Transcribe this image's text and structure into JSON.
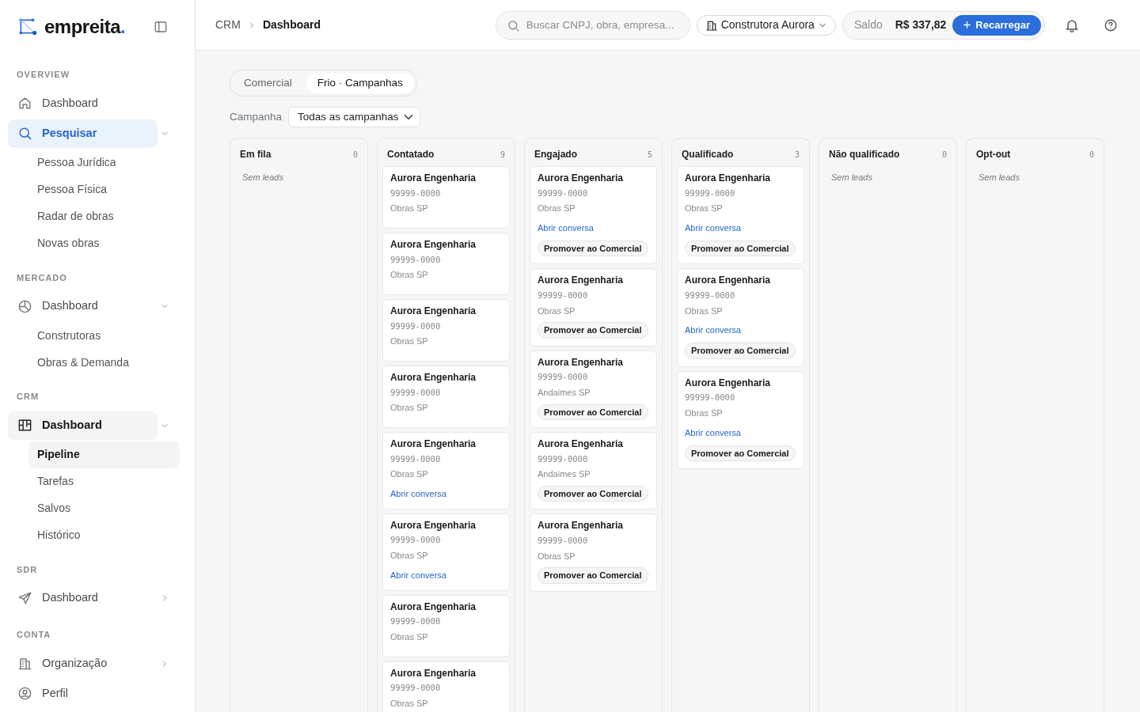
{
  "brand": {
    "name": "empreita",
    "dot": "."
  },
  "sidebar": {
    "sections": [
      {
        "title": "OVERVIEW",
        "items": [
          {
            "label": "Dashboard",
            "kind": "home",
            "selected": false
          },
          {
            "label": "Pesquisar",
            "kind": "search",
            "selected": true,
            "expanded": true,
            "children": [
              {
                "label": "Pessoa Jurídica",
                "selected": false
              },
              {
                "label": "Pessoa Física",
                "selected": false
              },
              {
                "label": "Radar de obras",
                "selected": false
              },
              {
                "label": "Novas obras",
                "selected": false
              }
            ]
          }
        ]
      },
      {
        "title": "MERCADO",
        "items": [
          {
            "label": "Dashboard",
            "kind": "pie",
            "selected": false,
            "expanded": true,
            "children": [
              {
                "label": "Construtoras",
                "selected": false
              },
              {
                "label": "Obras & Demanda",
                "selected": false
              }
            ]
          }
        ]
      },
      {
        "title": "CRM",
        "items": [
          {
            "label": "Dashboard",
            "kind": "board",
            "selected": false,
            "open": true,
            "expanded": true,
            "children": [
              {
                "label": "Pipeline",
                "selected": true
              },
              {
                "label": "Tarefas",
                "selected": false
              },
              {
                "label": "Salvos",
                "selected": false
              },
              {
                "label": "Histórico",
                "selected": false
              }
            ]
          }
        ]
      },
      {
        "title": "SDR",
        "items": [
          {
            "label": "Dashboard",
            "kind": "send",
            "selected": false,
            "expanded": false
          }
        ]
      },
      {
        "title": "CONTA",
        "items": [
          {
            "label": "Organização",
            "kind": "building",
            "selected": false,
            "expanded": false
          },
          {
            "label": "Perfil",
            "kind": "user",
            "selected": false
          }
        ]
      }
    ]
  },
  "breadcrumb": [
    "CRM",
    "Dashboard"
  ],
  "search": {
    "placeholder": "Buscar CNPJ, obra, empresa..."
  },
  "company": "Construtora Aurora",
  "balance": {
    "label": "Saldo",
    "value": "R$ 337,82",
    "button": "Recarregar"
  },
  "tabs": [
    {
      "label": "Comercial",
      "selected": false
    },
    {
      "label": "Frio · Campanhas",
      "selected": true
    }
  ],
  "filter": {
    "label": "Campanha",
    "value": "Todas as campanhas"
  },
  "columns": [
    {
      "title": "Em fila",
      "count": "0",
      "empty": "Sem leads"
    },
    {
      "title": "Contatado",
      "count": "9",
      "cards": [
        {
          "name": "Aurora Engenharia",
          "phone": "99999-0000",
          "segment": "Obras SP"
        },
        {
          "name": "Aurora Engenharia",
          "phone": "99999-0000",
          "segment": "Obras SP"
        },
        {
          "name": "Aurora Engenharia",
          "phone": "99999-0000",
          "segment": "Obras SP"
        },
        {
          "name": "Aurora Engenharia",
          "phone": "99999-0000",
          "segment": "Obras SP"
        },
        {
          "name": "Aurora Engenharia",
          "phone": "99999-0000",
          "segment": "Obras SP",
          "link": "Abrir conversa"
        },
        {
          "name": "Aurora Engenharia",
          "phone": "99999-0000",
          "segment": "Obras SP",
          "link": "Abrir conversa"
        },
        {
          "name": "Aurora Engenharia",
          "phone": "99999-0000",
          "segment": "Obras SP"
        },
        {
          "name": "Aurora Engenharia",
          "phone": "99999-0000",
          "segment": "Obras SP"
        }
      ]
    },
    {
      "title": "Engajado",
      "count": "5",
      "cards": [
        {
          "name": "Aurora Engenharia",
          "phone": "99999-0000",
          "segment": "Obras SP",
          "link": "Abrir conversa",
          "action": "Promover ao Comercial"
        },
        {
          "name": "Aurora Engenharia",
          "phone": "99999-0000",
          "segment": "Obras SP",
          "action": "Promover ao Comercial"
        },
        {
          "name": "Aurora Engenharia",
          "phone": "99999-0000",
          "segment": "Andaimes SP",
          "action": "Promover ao Comercial"
        },
        {
          "name": "Aurora Engenharia",
          "phone": "99999-0000",
          "segment": "Andaimes SP",
          "action": "Promover ao Comercial"
        },
        {
          "name": "Aurora Engenharia",
          "phone": "99999-0000",
          "segment": "Obras SP",
          "action": "Promover ao Comercial"
        }
      ]
    },
    {
      "title": "Qualificado",
      "count": "3",
      "cards": [
        {
          "name": "Aurora Engenharia",
          "phone": "99999-0000",
          "segment": "Obras SP",
          "link": "Abrir conversa",
          "action": "Promover ao Comercial"
        },
        {
          "name": "Aurora Engenharia",
          "phone": "99999-0000",
          "segment": "Obras SP",
          "link": "Abrir conversa",
          "action": "Promover ao Comercial"
        },
        {
          "name": "Aurora Engenharia",
          "phone": "99999-0000",
          "segment": "Obras SP",
          "link": "Abrir conversa",
          "action": "Promover ao Comercial"
        }
      ]
    },
    {
      "title": "Não qualificado",
      "count": "0",
      "empty": "Sem leads"
    },
    {
      "title": "Opt-out",
      "count": "0",
      "empty": "Sem leads"
    }
  ]
}
